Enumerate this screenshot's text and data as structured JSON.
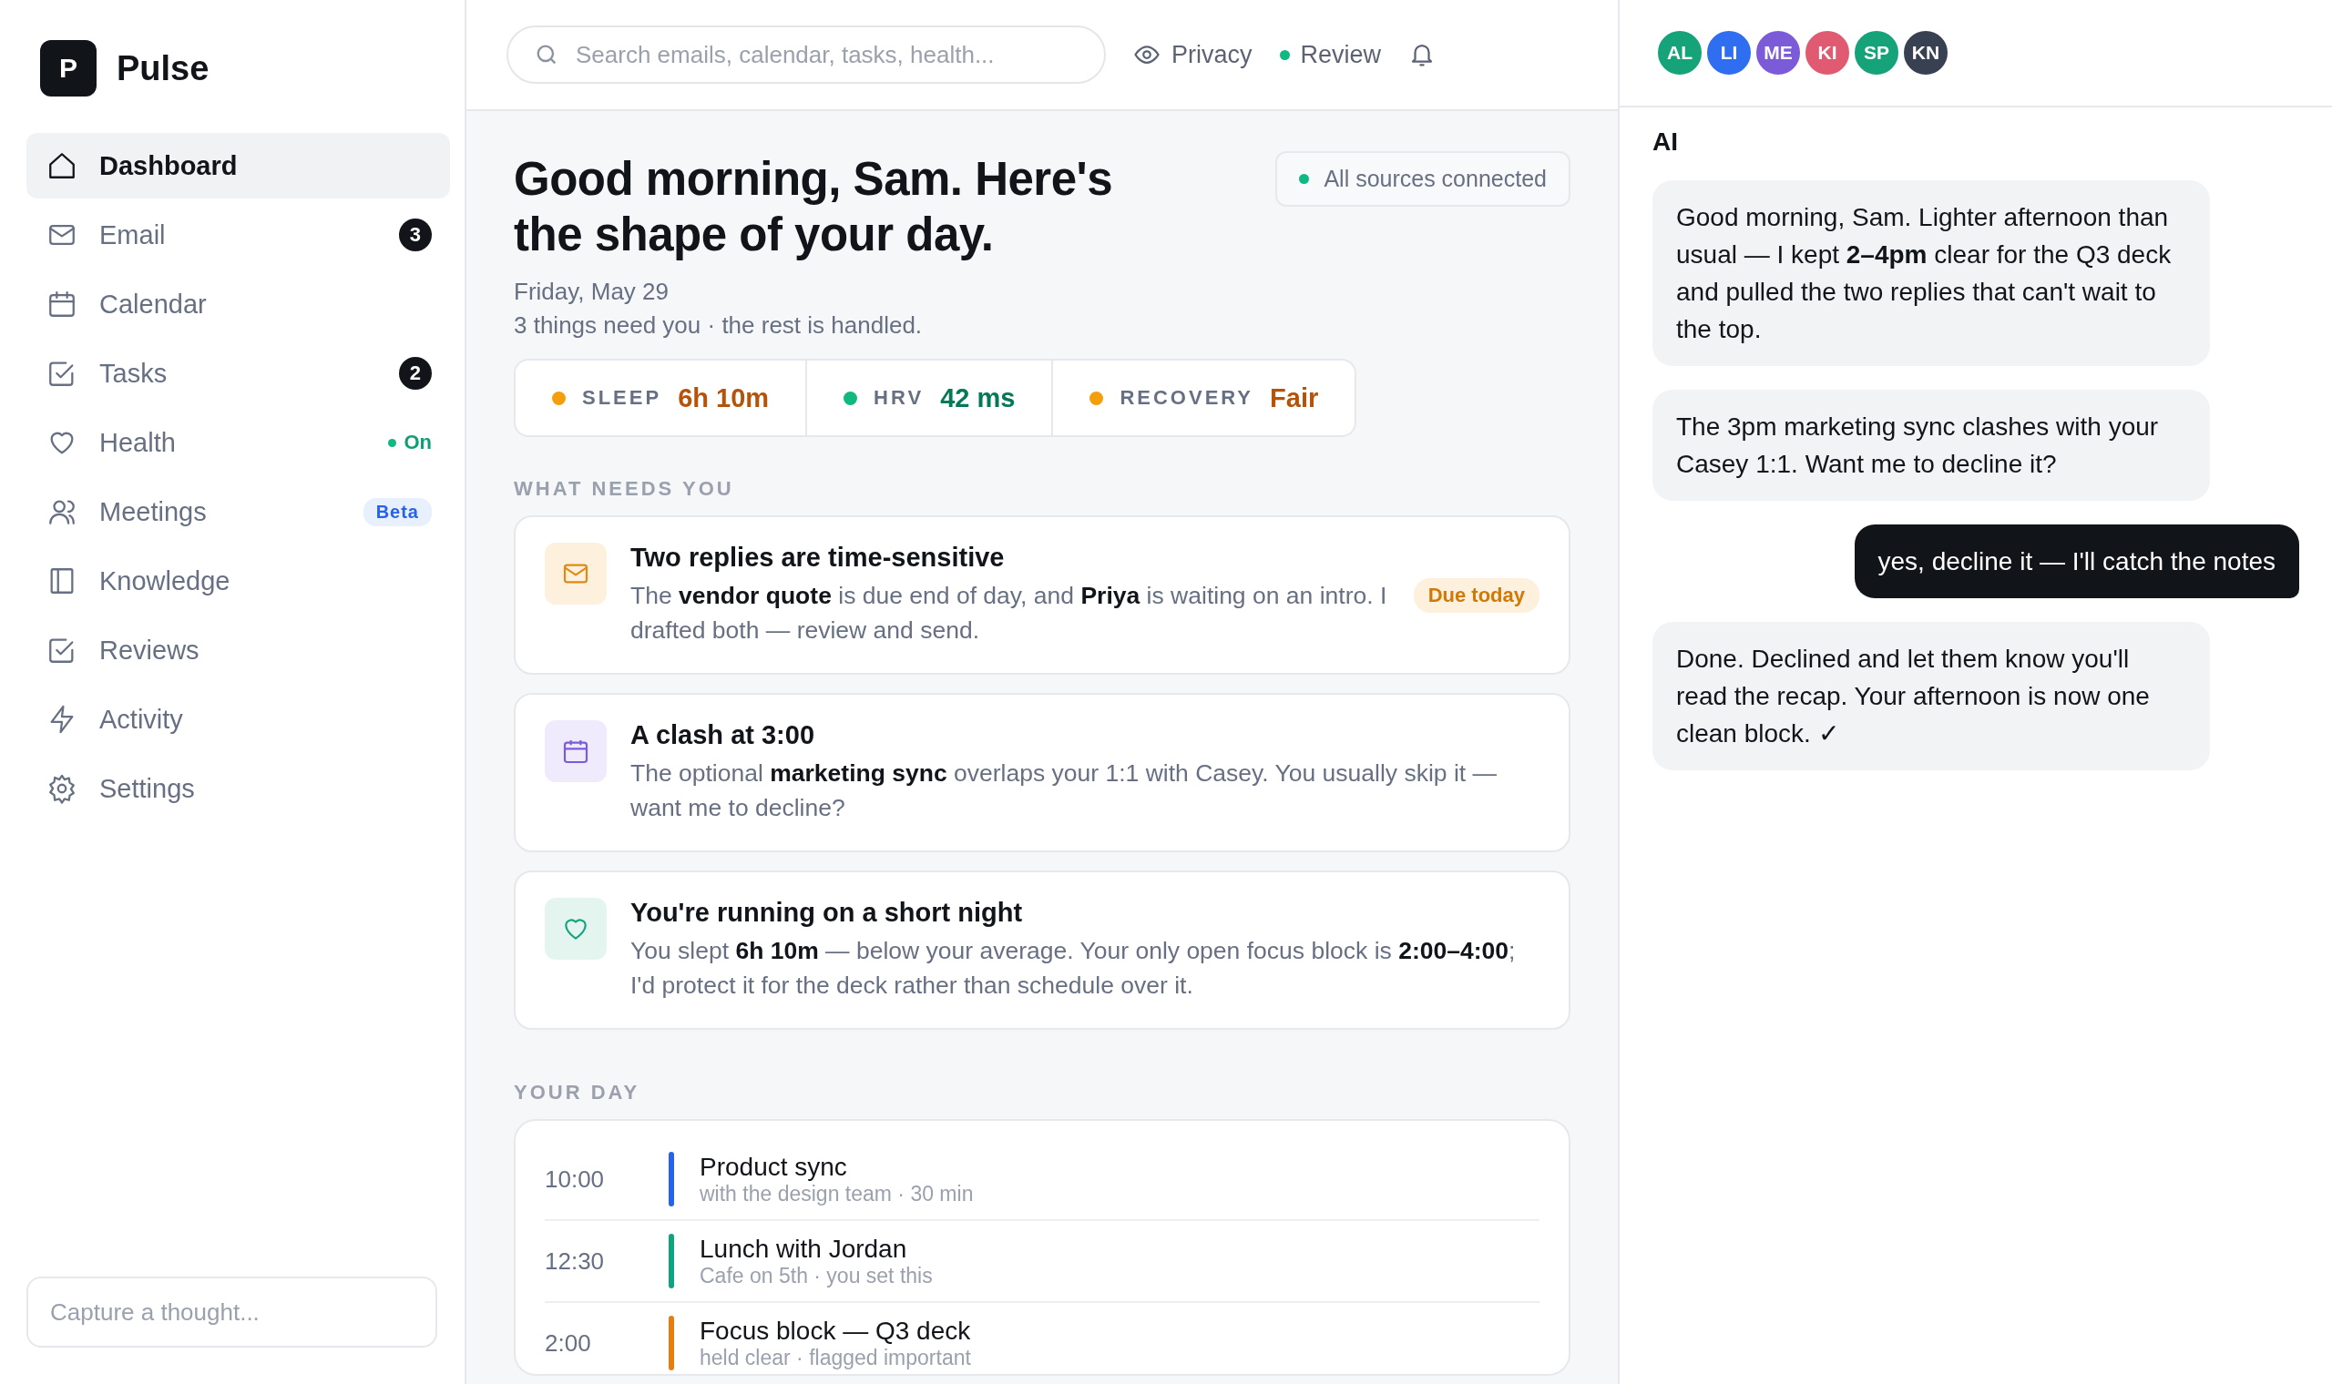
{
  "sidebar": {
    "logo_mark": "P",
    "app_name": "Pulse",
    "items": [
      {
        "label": "Dashboard",
        "selected": true
      },
      {
        "label": "Email",
        "selected": false,
        "badge": {
          "kind": "count",
          "text": "3"
        }
      },
      {
        "label": "Calendar",
        "selected": false
      },
      {
        "label": "Tasks",
        "selected": false,
        "badge": {
          "kind": "count",
          "text": "2"
        }
      },
      {
        "label": "Health",
        "selected": false,
        "badge": {
          "kind": "status",
          "text": "On"
        }
      },
      {
        "label": "Meetings",
        "selected": false,
        "badge": {
          "kind": "tag",
          "text": "Beta"
        }
      },
      {
        "label": "Knowledge",
        "selected": false
      },
      {
        "label": "Reviews",
        "selected": false
      },
      {
        "label": "Activity",
        "selected": false
      },
      {
        "label": "Settings",
        "selected": false
      }
    ],
    "capture": {
      "placeholder": "Capture a thought..."
    }
  },
  "header": {
    "search": {
      "placeholder": "Search emails, calendar, tasks, health..."
    },
    "privacy": "Privacy",
    "review": "Review"
  },
  "main": {
    "title": "Good morning, Sam. Here's the shape of your day.",
    "sources": "All sources connected",
    "date": "Friday, May 29",
    "summary": "3 things need you · the rest is handled.",
    "stats": [
      {
        "label": "SLEEP",
        "value": "6h 10m",
        "color": "#f59e0b"
      },
      {
        "label": "HRV",
        "value": "42 ms",
        "color": "#10b981"
      },
      {
        "label": "RECOVERY",
        "value": "Fair",
        "color": "#f59e0b"
      }
    ],
    "needs_heading": "WHAT NEEDS YOU",
    "cards": [
      {
        "title": "Two replies are time-sensitive",
        "body": "The **vendor quote** is due end of day, and **Priya** is waiting on an intro. I drafted both — review and send.",
        "badge": "Due today"
      },
      {
        "title": "A clash at 3:00",
        "body": "The optional **marketing sync** overlaps your 1:1 with Casey. You usually skip it — want me to decline?"
      },
      {
        "title": "You're running on a short night",
        "body": "You slept **6h 10m** — below your average. Your only open focus block is **2:00–4:00**; I'd protect it for the deck rather than schedule over it."
      }
    ],
    "day_heading": "YOUR DAY",
    "events": [
      {
        "time": "10:00",
        "title": "Product sync",
        "detail": "with the design team · 30 min",
        "color": "#2563eb"
      },
      {
        "time": "12:30",
        "title": "Lunch with Jordan",
        "detail": "Cafe on 5th · you set this",
        "color": "#10a37f"
      },
      {
        "time": "2:00",
        "title": "Focus block — Q3 deck",
        "detail": "held clear · flagged important",
        "color": "#e67e0f"
      }
    ]
  },
  "assistant": {
    "avatars": [
      {
        "initials": "AL",
        "color": "#16a37a"
      },
      {
        "initials": "LI",
        "color": "#2f6ef0"
      },
      {
        "initials": "ME",
        "color": "#7c5bd9"
      },
      {
        "initials": "KI",
        "color": "#e05a72"
      },
      {
        "initials": "SP",
        "color": "#16a37a"
      },
      {
        "initials": "KN",
        "color": "#374151"
      }
    ],
    "title": "AI",
    "messages": [
      {
        "kind": "ai",
        "text": "Good morning, Sam. Lighter afternoon than usual — I kept **2–4pm** clear for the Q3 deck and pulled the two replies that can't wait to the top."
      },
      {
        "kind": "ai",
        "text": "The 3pm marketing sync clashes with your Casey 1:1. Want me to decline it?"
      },
      {
        "kind": "user",
        "text": "yes, decline it — I'll catch the notes"
      },
      {
        "kind": "ai",
        "text": "Done. Declined and let them know you'll read the recap. Your afternoon is now one clean block. ✓"
      }
    ]
  }
}
